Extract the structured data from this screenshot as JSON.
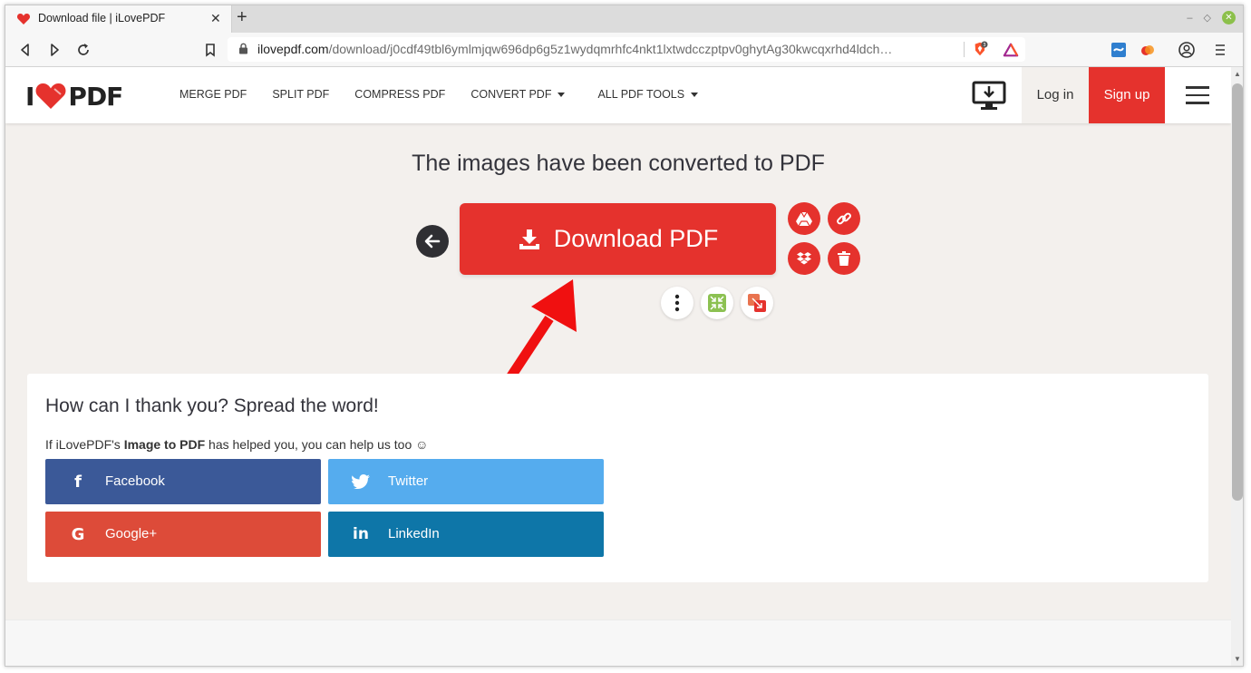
{
  "browser": {
    "tab_title": "Download file | iLovePDF",
    "tab_close": "✕",
    "new_tab": "+",
    "url_host": "ilovepdf.com",
    "url_path": "/download/j0cdf49tbl6ymlmjqw696dp6g5z1wydqmrhfc4nkt1lxtwdcczptpv0ghytAg30kwcqxrhd4ldch…",
    "brave_badge": "3"
  },
  "site": {
    "logo_left": "I",
    "logo_right": "PDF",
    "menu": [
      {
        "label": "MERGE PDF"
      },
      {
        "label": "SPLIT PDF"
      },
      {
        "label": "COMPRESS PDF"
      },
      {
        "label": "CONVERT PDF"
      },
      {
        "label": "ALL PDF TOOLS"
      }
    ],
    "login": "Log in",
    "signup": "Sign up"
  },
  "main": {
    "heading": "The images have been converted to PDF",
    "download_label": "Download PDF"
  },
  "share": {
    "title": "How can I thank you? Spread the word!",
    "sub_prefix": "If iLovePDF's ",
    "sub_bold": "Image to PDF",
    "sub_suffix": " has helped you, you can help us too ☺",
    "buttons": [
      {
        "label": "Facebook",
        "icon": "f",
        "color": "#3b5998"
      },
      {
        "label": "Twitter",
        "icon": "twitter-bird",
        "color": "#55acee"
      },
      {
        "label": "Google+",
        "icon": "G",
        "color": "#dd4b39"
      },
      {
        "label": "LinkedIn",
        "icon": "in",
        "color": "#0e76a8"
      }
    ]
  },
  "colors": {
    "brand_red": "#e5322d",
    "page_bg": "#f3f0ed"
  }
}
